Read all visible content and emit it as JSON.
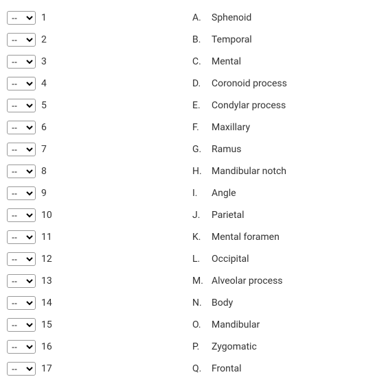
{
  "placeholder": "--",
  "left_items": [
    {
      "number": "1"
    },
    {
      "number": "2"
    },
    {
      "number": "3"
    },
    {
      "number": "4"
    },
    {
      "number": "5"
    },
    {
      "number": "6"
    },
    {
      "number": "7"
    },
    {
      "number": "8"
    },
    {
      "number": "9"
    },
    {
      "number": "10"
    },
    {
      "number": "11"
    },
    {
      "number": "12"
    },
    {
      "number": "13"
    },
    {
      "number": "14"
    },
    {
      "number": "15"
    },
    {
      "number": "16"
    },
    {
      "number": "17"
    }
  ],
  "right_items": [
    {
      "letter": "A.",
      "term": "Sphenoid"
    },
    {
      "letter": "B.",
      "term": "Temporal"
    },
    {
      "letter": "C.",
      "term": "Mental"
    },
    {
      "letter": "D.",
      "term": "Coronoid process"
    },
    {
      "letter": "E.",
      "term": "Condylar process"
    },
    {
      "letter": "F.",
      "term": "Maxillary"
    },
    {
      "letter": "G.",
      "term": "Ramus"
    },
    {
      "letter": "H.",
      "term": "Mandibular notch"
    },
    {
      "letter": "I.",
      "term": "Angle"
    },
    {
      "letter": "J.",
      "term": "Parietal"
    },
    {
      "letter": "K.",
      "term": "Mental foramen"
    },
    {
      "letter": "L.",
      "term": "Occipital"
    },
    {
      "letter": "M.",
      "term": "Alveolar process"
    },
    {
      "letter": "N.",
      "term": "Body"
    },
    {
      "letter": "O.",
      "term": "Mandibular"
    },
    {
      "letter": "P.",
      "term": "Zygomatic"
    },
    {
      "letter": "Q.",
      "term": "Frontal"
    }
  ]
}
